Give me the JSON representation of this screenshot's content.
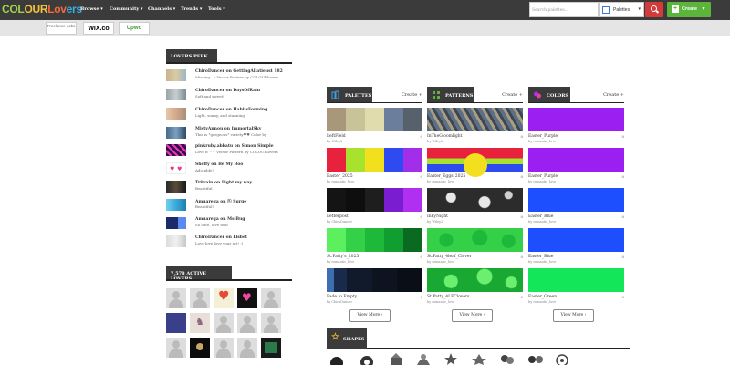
{
  "header": {
    "logo": {
      "part1": "COL",
      "part2": "OUR",
      "part3": "Lov",
      "part4": "ers"
    },
    "nav": [
      "Browse ▾",
      "Community ▾",
      "Channels ▾",
      "Trends ▾",
      "Tools ▾"
    ],
    "search": {
      "placeholder": "Search palettes...",
      "type": "Palettes",
      "chevron": "▾"
    },
    "create_label": "Create",
    "create_chevron": "▾"
  },
  "ads": {
    "freelance": "Freelance Jobs",
    "wix": "WIX.co",
    "upwork": "Upwo"
  },
  "sidebar": {
    "lovers_peek_title": "LOVERS PEEK",
    "peek": [
      {
        "who": "ChiroDancer on GettingAllatieust 182",
        "msg": "Missing... - Vector Pattern by COLOURlovers"
      },
      {
        "who": "ChiroDancer on DaysOfRain",
        "msg": "Soft and sweet!"
      },
      {
        "who": "ChiroDancer on HabitsForming",
        "msg": "Light, sunny, and stunning!"
      },
      {
        "who": "MistyAnnou on ImmortalSky",
        "msg": "This is *gorgeous* variety♥♥ Color by"
      },
      {
        "who": "pinkruby.abbatu on Simon Simple",
        "msg": "Love it ^^ Vector Pattern by COLOURlovers"
      },
      {
        "who": "Sheffy on Be My Boo",
        "msg": "Adorable!"
      },
      {
        "who": "Tritrain on Light my way...",
        "msg": "Beautiful !"
      },
      {
        "who": "Amuarega on ⓗ Surge",
        "msg": "Beautiful!"
      },
      {
        "who": "Amuarega on Ms Bug",
        "msg": "So cute, love this!"
      },
      {
        "who": "ChiroDancer on Lisbet",
        "msg": "Love love love your art! :)"
      }
    ],
    "active_title": "7,578 ACTIVE LOVERS"
  },
  "palettes": {
    "title": "PALETTES",
    "create": "Create +",
    "view_more": "View More ›",
    "items": [
      {
        "name": "LeftField",
        "by": "by Wiley2",
        "count": "0"
      },
      {
        "name": "Easter_2025",
        "by": "by romantic_love",
        "count": "0"
      },
      {
        "name": "Letterpost",
        "by": "by ChiroDancer",
        "count": "0"
      },
      {
        "name": "St.Patty's_2025",
        "by": "by romantic_love",
        "count": "0"
      },
      {
        "name": "Fade to Empty",
        "by": "by ChiroDancer",
        "count": "0"
      }
    ]
  },
  "patterns": {
    "title": "PATTERNS",
    "create": "Create +",
    "view_more": "View More ›",
    "items": [
      {
        "name": "InTheGloomlight",
        "by": "by Wiley2",
        "count": "0"
      },
      {
        "name": "Easter_Eggs_2025",
        "by": "by romantic_love",
        "count": "0"
      },
      {
        "name": "InkyNight",
        "by": "by Wiley2",
        "count": "0"
      },
      {
        "name": "St.Patty_4leaf_Clover",
        "by": "by romantic_love",
        "count": "0"
      },
      {
        "name": "St.Patty_4LFClovers",
        "by": "by romantic_love",
        "count": "0"
      }
    ]
  },
  "colors": {
    "title": "COLORS",
    "create": "Create +",
    "view_more": "View More ›",
    "items": [
      {
        "name": "Easter_Purple",
        "by": "by romantic_love",
        "count": "0",
        "hex": "#9b1ff0"
      },
      {
        "name": "Easter_Purple",
        "by": "by romantic_love",
        "count": "0",
        "hex": "#9b1ff0"
      },
      {
        "name": "Easter_Blue",
        "by": "by romantic_love",
        "count": "0",
        "hex": "#1e4fff"
      },
      {
        "name": "Easter_Blue",
        "by": "by romantic_love",
        "count": "0",
        "hex": "#1e4fff"
      },
      {
        "name": "Easter_Green",
        "by": "by romantic_love",
        "count": "0",
        "hex": "#14e65a"
      }
    ]
  },
  "shapes": {
    "title": "SHAPES"
  },
  "accent_colors": {
    "topbar": "#3b3b3b",
    "search_button": "#d33a3a",
    "create_button": "#5ab53a"
  }
}
